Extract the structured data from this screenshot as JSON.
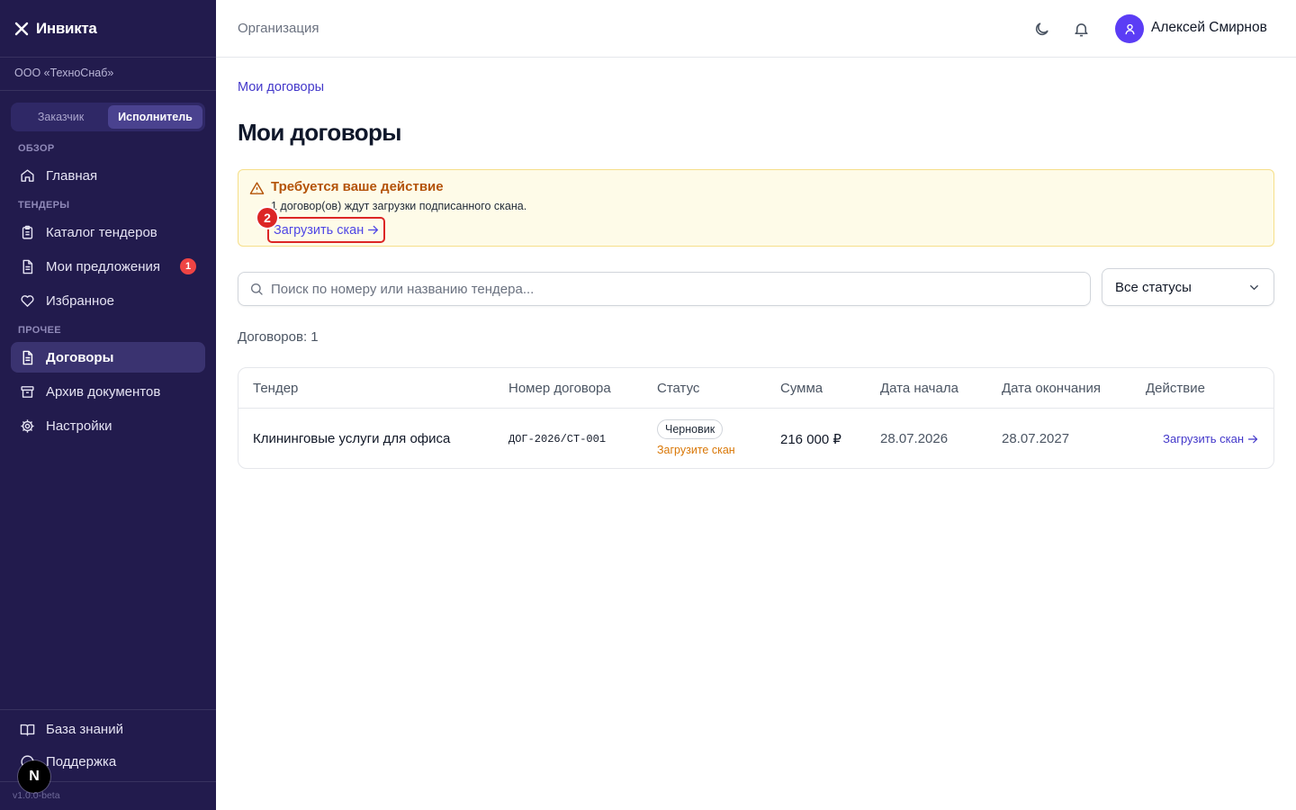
{
  "sidebar": {
    "brand": "Инвикта",
    "org": "ООО «ТехноСнаб»",
    "roles": [
      "Заказчик",
      "Исполнитель"
    ],
    "active_role": "Исполнитель",
    "sections": {
      "overview": "ОБЗОР",
      "tenders": "ТЕНДЕРЫ",
      "other": "ПРОЧЕЕ"
    },
    "items": [
      {
        "label": "Главная",
        "icon": "home-icon"
      },
      {
        "label": "Каталог тендеров",
        "icon": "clipboard-icon"
      },
      {
        "label": "Мои предложения",
        "icon": "document-icon",
        "badge": "1"
      },
      {
        "label": "Избранное",
        "icon": "heart-icon"
      },
      {
        "label": "Договоры",
        "icon": "contract-icon",
        "active": true
      },
      {
        "label": "Архив документов",
        "icon": "archive-icon"
      },
      {
        "label": "Настройки",
        "icon": "gear-icon"
      }
    ],
    "footer": [
      {
        "label": "База знаний",
        "icon": "book-icon"
      },
      {
        "label": "Поддержка",
        "icon": "help-icon"
      }
    ],
    "next_badge": "N",
    "version": "v1.0.0-beta"
  },
  "header": {
    "section": "Организация",
    "user_name": "Алексей Смирнов"
  },
  "main": {
    "breadcrumb": "Мои договоры",
    "title": "Мои договоры",
    "alert": {
      "title": "Требуется ваше действие",
      "text": "1 договор(ов) ждут загрузки подписанного скана.",
      "link": "Загрузить скан",
      "step": "2"
    },
    "search": {
      "placeholder": "Поиск по номеру или названию тендера..."
    },
    "status_filter": "Все статусы",
    "count": "Договоров: 1",
    "table": {
      "columns": [
        "Тендер",
        "Номер договора",
        "Статус",
        "Сумма",
        "Дата начала",
        "Дата окончания",
        "Действие"
      ],
      "rows": [
        {
          "tender": "Клининговые услуги для офиса",
          "number": "ДОГ-2026/СТ-001",
          "status": "Черновик",
          "status_note": "Загрузите скан",
          "amount": "216 000 ₽",
          "start": "28.07.2026",
          "end": "28.07.2027",
          "action": "Загрузить скан"
        }
      ]
    }
  },
  "colors": {
    "sidebar_bg": "#221b4d",
    "accent": "#4338ca",
    "alert_title": "#b45309",
    "highlight": "#dc2626",
    "badge": "#ef4444"
  }
}
